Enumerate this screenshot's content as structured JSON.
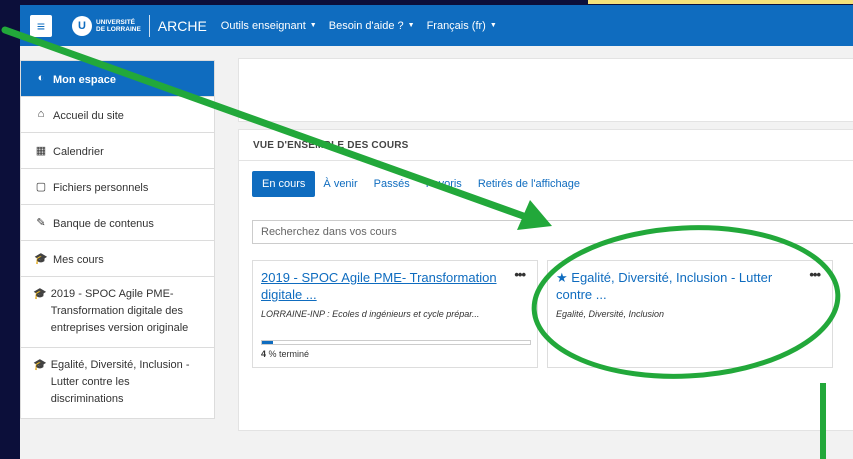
{
  "navbar": {
    "menu_icon": "≡",
    "logo_letter": "U",
    "logo_line1": "UNIVERSITÉ",
    "logo_line2": "DE LORRAINE",
    "app_name": "ARCHE",
    "items": [
      {
        "label": "Outils enseignant"
      },
      {
        "label": "Besoin d'aide ?"
      },
      {
        "label": "Français (fr)"
      }
    ],
    "caret": "▼"
  },
  "sidebar": {
    "items": [
      {
        "icon": "dashboard-icon",
        "glyph": "◐",
        "label": "Mon espace"
      },
      {
        "icon": "home-icon",
        "glyph": "⌂",
        "label": "Accueil du site"
      },
      {
        "icon": "calendar-icon",
        "glyph": "▦",
        "label": "Calendrier"
      },
      {
        "icon": "file-icon",
        "glyph": "▢",
        "label": "Fichiers personnels"
      },
      {
        "icon": "brush-icon",
        "glyph": "✎",
        "label": "Banque de contenus"
      },
      {
        "icon": "graduation-cap-icon",
        "glyph": "🎓",
        "label": "Mes cours"
      },
      {
        "icon": "graduation-cap-icon",
        "glyph": "🎓",
        "label": "2019 - SPOC Agile PME-Transformation digitale des entreprises version originale"
      },
      {
        "icon": "graduation-cap-icon",
        "glyph": "🎓",
        "label": "Egalité, Diversité, Inclusion - Lutter contre les discriminations"
      }
    ]
  },
  "overview": {
    "title": "VUE D'ENSEMBLE DES COURS",
    "tabs": [
      {
        "label": "En cours"
      },
      {
        "label": "À venir"
      },
      {
        "label": "Passés"
      },
      {
        "label": "Favoris"
      },
      {
        "label": "Retirés de l'affichage"
      }
    ],
    "search_placeholder": "Recherchez dans vos cours",
    "courses": [
      {
        "title": "2019 - SPOC Agile PME- Transformation digitale ...",
        "category": "LORRAINE-INP : Ecoles d ingénieurs et cycle prépar...",
        "menu": "•••",
        "progress_percent": 4,
        "progress_value": "4",
        "progress_suffix": " % terminé"
      },
      {
        "star": "★",
        "title": "Egalité, Diversité, Inclusion - Lutter contre ...",
        "category": "Egalité, Diversité, Inclusion",
        "menu": "•••"
      }
    ]
  },
  "colors": {
    "primary": "#0f6cbf",
    "annotation": "#22a83a",
    "background": "#0c0f3a"
  }
}
